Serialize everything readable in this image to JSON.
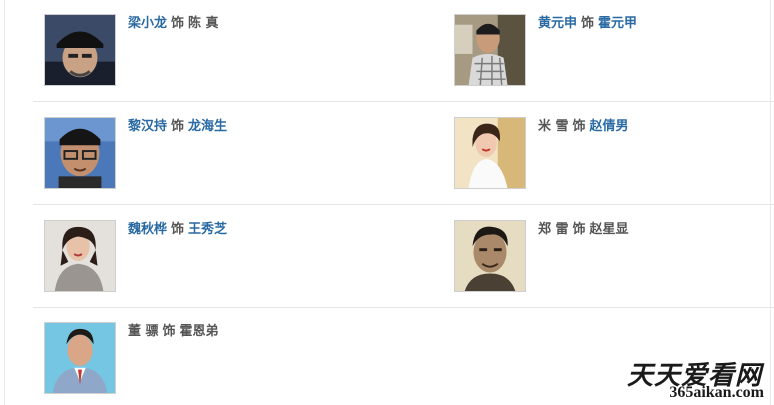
{
  "cast": [
    {
      "actor": "梁小龙",
      "connector": "饰",
      "character": "陈 真",
      "actor_link": true,
      "character_link": false,
      "photo": "actor-photo-black-cap"
    },
    {
      "actor": "黄元申",
      "connector": "饰",
      "character": "霍元甲",
      "actor_link": true,
      "character_link": true,
      "photo": "actor-photo-plaid-shirt"
    },
    {
      "actor": "黎汉持",
      "connector": "饰",
      "character": "龙海生",
      "actor_link": true,
      "character_link": true,
      "photo": "actor-photo-glasses"
    },
    {
      "actor": "米 雪",
      "connector": "饰",
      "character": "赵倩男",
      "actor_link": false,
      "character_link": true,
      "photo": "actress-photo-white-top"
    },
    {
      "actor": "魏秋桦",
      "connector": "饰",
      "character": "王秀芝",
      "actor_link": true,
      "character_link": true,
      "photo": "actress-photo-grey-sweater"
    },
    {
      "actor": "郑 雷",
      "connector": "饰",
      "character": "赵星显",
      "actor_link": false,
      "character_link": false,
      "photo": "actor-photo-vintage-portrait"
    },
    {
      "actor": "董 骠",
      "connector": "饰",
      "character": "霍恩弟",
      "actor_link": false,
      "character_link": false,
      "photo": "actor-photo-blue-suit"
    }
  ],
  "watermark": {
    "title": "天天爱看网",
    "url": "365aikan.com"
  },
  "colors": {
    "link": "#2a6aa3",
    "text": "#555555",
    "divider": "#e6e6e6"
  }
}
